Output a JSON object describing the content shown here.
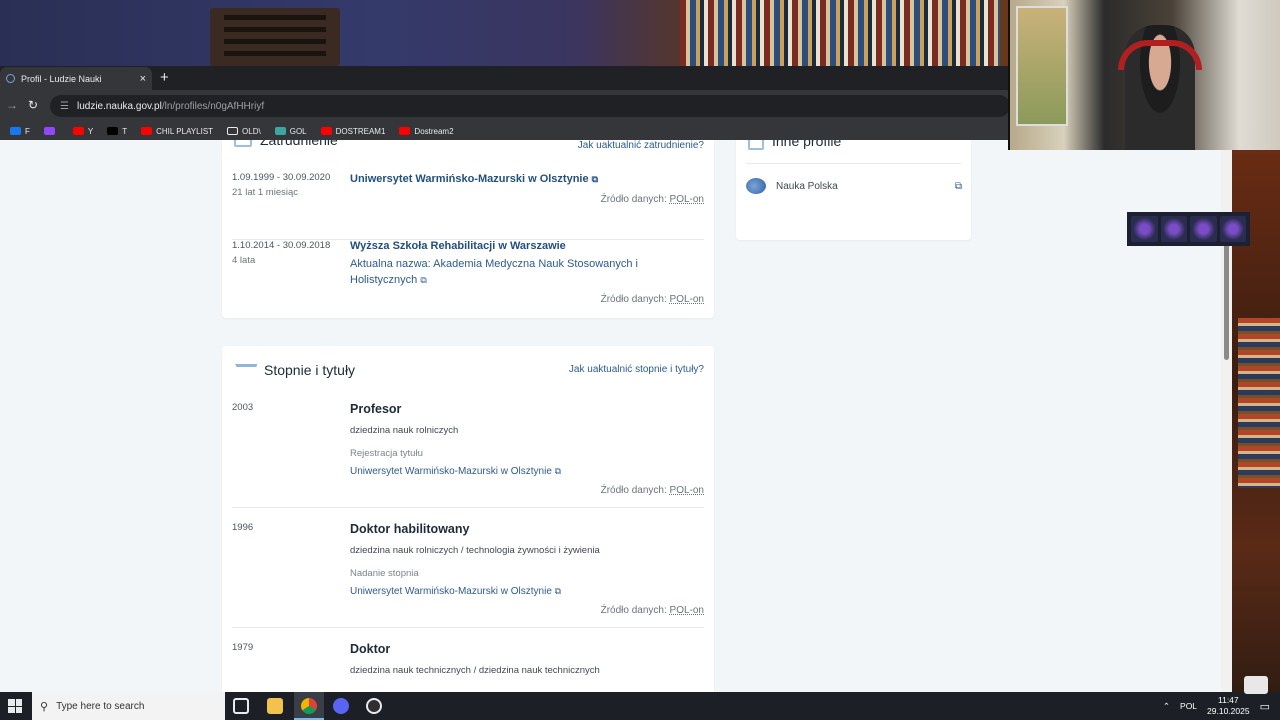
{
  "browser": {
    "tab_title": "Profil - Ludzie Nauki",
    "new_tab": "+",
    "tab_close": "×",
    "url_host": "ludzie.nauka.gov.pl",
    "url_path": "/ln/profiles/n0gAfHHriyf",
    "bookmarks": [
      {
        "label": "F",
        "color": "#1877f2"
      },
      {
        "label": "",
        "color": "#9146ff"
      },
      {
        "label": "Y",
        "color": "#ff0000"
      },
      {
        "label": "T",
        "color": "#000000"
      },
      {
        "label": "CHIL PLAYLIST",
        "color": "#ff0000"
      },
      {
        "label": "OLD\\",
        "color": "folder"
      },
      {
        "label": "GOL",
        "color": "#3aa7a0"
      },
      {
        "label": "DOSTREAM1",
        "color": "#ff0000"
      },
      {
        "label": "Dostream2",
        "color": "#ff0000"
      }
    ]
  },
  "employment": {
    "title": "Zatrudnienie",
    "help": "Jak uaktualnić zatrudnienie?",
    "items": [
      {
        "dates": "1.09.1999 - 30.09.2020",
        "duration": "21 lat 1 miesiąc",
        "org": "Uniwersytet Warmińsko-Mazurski w Olsztynie",
        "source_prefix": "Źródło danych:",
        "source": "POL-on"
      },
      {
        "dates": "1.10.2014 - 30.09.2018",
        "duration": "4 lata",
        "org": "Wyższa Szkoła Rehabilitacji w Warszawie",
        "current_name": "Aktualna nazwa: Akademia Medyczna Nauk Stosowanych i Holistycznych",
        "source_prefix": "Źródło danych:",
        "source": "POL-on"
      }
    ]
  },
  "degrees": {
    "title": "Stopnie i tytuły",
    "help": "Jak uaktualnić stopnie i tytuły?",
    "items": [
      {
        "year": "2003",
        "title": "Profesor",
        "field": "dziedzina nauk rolniczych",
        "label": "Rejestracja tytułu",
        "org": "Uniwersytet Warmińsko-Mazurski w Olsztynie",
        "source_prefix": "Źródło danych:",
        "source": "POL-on"
      },
      {
        "year": "1996",
        "title": "Doktor habilitowany",
        "field": "dziedzina nauk rolniczych / technologia żywności i żywienia",
        "label": "Nadanie stopnia",
        "org": "Uniwersytet Warmińsko-Mazurski w Olsztynie",
        "source_prefix": "Źródło danych:",
        "source": "POL-on"
      },
      {
        "year": "1979",
        "title": "Doktor",
        "field": "dziedzina nauk technicznych / dziedzina nauk technicznych"
      }
    ]
  },
  "other_profiles": {
    "title": "Inne profile",
    "items": [
      {
        "label": "Nauka Polska"
      }
    ]
  },
  "taskbar": {
    "search_placeholder": "Type here to search",
    "language": "POL",
    "time": "11:47",
    "date": "29.10.2025"
  }
}
